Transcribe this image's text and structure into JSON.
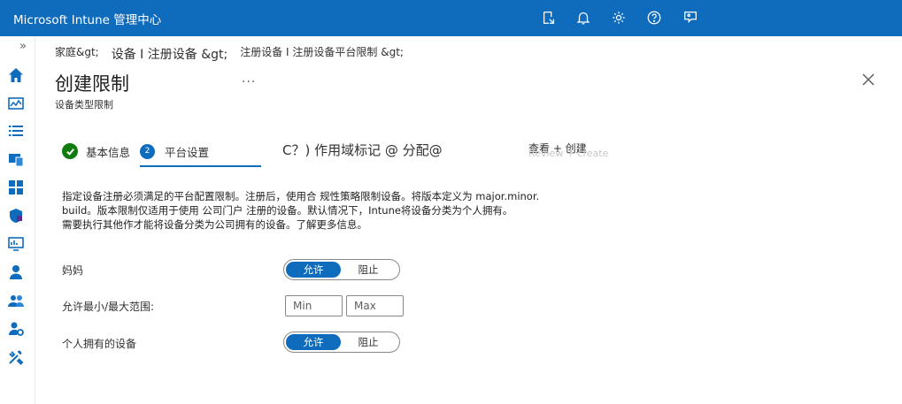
{
  "app": {
    "title": "Microsoft Intune 管理中心"
  },
  "topbar": {
    "icons": [
      "feedback-share-icon",
      "bell-icon",
      "gear-icon",
      "help-icon",
      "person-feedback-icon"
    ]
  },
  "rail": {
    "expand_glyph": "»",
    "items": [
      "home-icon",
      "dashboard-icon",
      "all-services-icon",
      "devices-icon",
      "apps-icon",
      "endpoint-security-icon",
      "reports-icon",
      "users-icon",
      "groups-icon",
      "tenant-admin-icon",
      "troubleshooting-icon"
    ]
  },
  "breadcrumb": {
    "item1": "家庭&gt;",
    "item2": "设备 I 注册设备 &gt;",
    "item3": "注册设备 I 注册设备平台限制 &gt;"
  },
  "page": {
    "title": "创建限制",
    "more": "...",
    "subtitle": "设备类型限制"
  },
  "tabs": {
    "step1_label": "基本信息",
    "step2_number": "2",
    "step2_label": "平台设置",
    "step3_label": "C？) 作用域标记 @ 分配@",
    "step4_label": "查看 + 创建",
    "step4_ghost": "Review + create"
  },
  "description": {
    "line1": "指定设备注册必须满足的平台配置限制。注册后，使用合 规性策略限制设备。将版本定义为 major.minor.",
    "line2": "build。版本限制仅适用于使用 公司门户 注册的设备。默认情况下，Intune将设备分类为个人拥有。",
    "line3": "需要执行其他作才能将设备分类为公司拥有的设备。了解更多信息。"
  },
  "form": {
    "row1": {
      "label": "妈妈",
      "allow": "允许",
      "block": "阻止",
      "selected": "允许"
    },
    "row2": {
      "label": "允许最小/最大范围:",
      "min_placeholder": "Min",
      "max_placeholder": "Max"
    },
    "row3": {
      "label": "个人拥有的设备",
      "allow": "允许",
      "block": "阻止",
      "selected": "允许"
    }
  },
  "colors": {
    "brand": "#0f6cbd",
    "success": "#107c10"
  }
}
